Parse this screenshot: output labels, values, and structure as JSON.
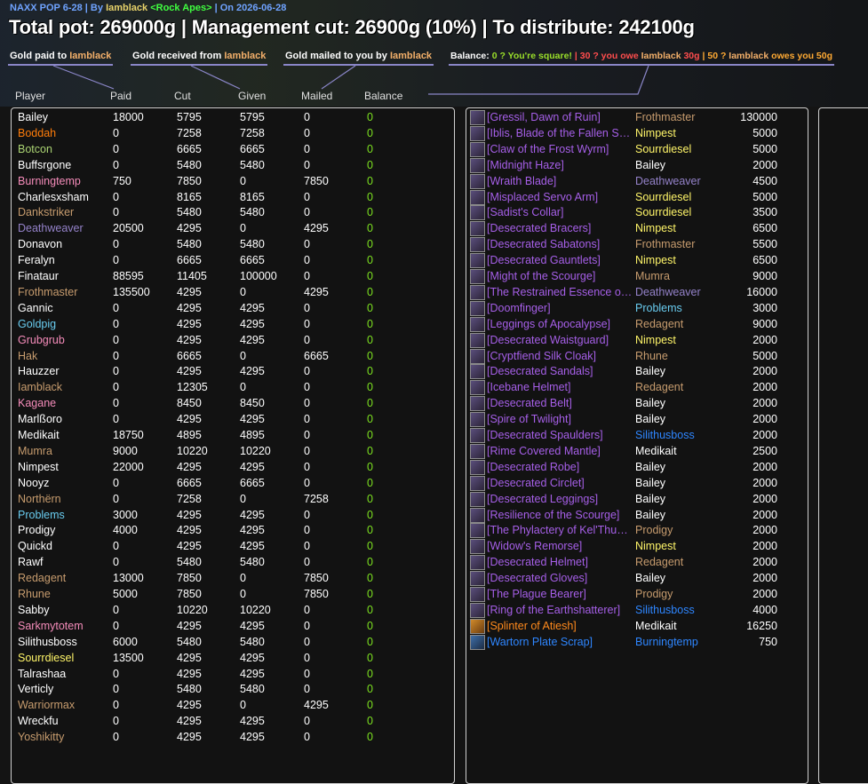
{
  "header": {
    "raid": "NAXX POP 6-28",
    "by_label": "| By",
    "author": "Iamblack",
    "guild": "<Rock Apes>",
    "date": "| On 2026-06-28"
  },
  "title": "Total pot: 269000g | Management cut: 26900g (10%) | To distribute: 242100g",
  "legend": {
    "paid_label": "Gold paid to",
    "paid_name": "Iamblack",
    "received_label": "Gold received from",
    "received_name": "Iamblack",
    "mailed_label": "Gold mailed to you by",
    "mailed_name": "Iamblack",
    "balance_label": "Balance:",
    "square": "0 ? You're square!",
    "sep": "|",
    "owe_prefix": "30 ? you owe",
    "owe_name": "Iamblack",
    "owe_amount": "30g",
    "owes_prefix": "50 ?",
    "owes_name": "Iamblack",
    "owes_suffix": "owes you 50g"
  },
  "columns": {
    "player": "Player",
    "paid": "Paid",
    "cut": "Cut",
    "given": "Given",
    "mailed": "Mailed",
    "balance": "Balance"
  },
  "colors": {
    "priest": "#ffffff",
    "druid": "#ff7d0a",
    "rogue": "#fff569",
    "hunter": "#abd473",
    "mage": "#69ccf0",
    "warlock": "#9482c9",
    "paladin": "#f58cba",
    "warrior": "#c79c6e",
    "epic": "#a65fe8",
    "legendary": "#ff8a1c",
    "rare": "#2e86ff",
    "balance_zero": "#7ce020"
  },
  "players": [
    {
      "name": "Bailey",
      "cls": "priest",
      "paid": "18000",
      "cut": "5795",
      "given": "5795",
      "mailed": "0",
      "balance": "0"
    },
    {
      "name": "Boddah",
      "cls": "druid",
      "paid": "0",
      "cut": "7258",
      "given": "7258",
      "mailed": "0",
      "balance": "0"
    },
    {
      "name": "Botcon",
      "cls": "hunter",
      "paid": "0",
      "cut": "6665",
      "given": "6665",
      "mailed": "0",
      "balance": "0"
    },
    {
      "name": "Buffsrgone",
      "cls": "priest",
      "paid": "0",
      "cut": "5480",
      "given": "5480",
      "mailed": "0",
      "balance": "0"
    },
    {
      "name": "Burningtemp",
      "cls": "paladin",
      "paid": "750",
      "cut": "7850",
      "given": "0",
      "mailed": "7850",
      "balance": "0"
    },
    {
      "name": "Charlesxsham",
      "cls": "priest",
      "paid": "0",
      "cut": "8165",
      "given": "8165",
      "mailed": "0",
      "balance": "0"
    },
    {
      "name": "Dankstriker",
      "cls": "warrior",
      "paid": "0",
      "cut": "5480",
      "given": "5480",
      "mailed": "0",
      "balance": "0"
    },
    {
      "name": "Deathweaver",
      "cls": "warlock",
      "paid": "20500",
      "cut": "4295",
      "given": "0",
      "mailed": "4295",
      "balance": "0"
    },
    {
      "name": "Donavon",
      "cls": "priest",
      "paid": "0",
      "cut": "5480",
      "given": "5480",
      "mailed": "0",
      "balance": "0"
    },
    {
      "name": "Feralyn",
      "cls": "priest",
      "paid": "0",
      "cut": "6665",
      "given": "6665",
      "mailed": "0",
      "balance": "0"
    },
    {
      "name": "Finataur",
      "cls": "priest",
      "paid": "88595",
      "cut": "11405",
      "given": "100000",
      "mailed": "0",
      "balance": "0"
    },
    {
      "name": "Frothmaster",
      "cls": "warrior",
      "paid": "135500",
      "cut": "4295",
      "given": "0",
      "mailed": "4295",
      "balance": "0"
    },
    {
      "name": "Gannic",
      "cls": "priest",
      "paid": "0",
      "cut": "4295",
      "given": "4295",
      "mailed": "0",
      "balance": "0"
    },
    {
      "name": "Goldpig",
      "cls": "mage",
      "paid": "0",
      "cut": "4295",
      "given": "4295",
      "mailed": "0",
      "balance": "0"
    },
    {
      "name": "Grubgrub",
      "cls": "paladin",
      "paid": "0",
      "cut": "4295",
      "given": "4295",
      "mailed": "0",
      "balance": "0"
    },
    {
      "name": "Hak",
      "cls": "warrior",
      "paid": "0",
      "cut": "6665",
      "given": "0",
      "mailed": "6665",
      "balance": "0"
    },
    {
      "name": "Hauzzer",
      "cls": "priest",
      "paid": "0",
      "cut": "4295",
      "given": "4295",
      "mailed": "0",
      "balance": "0"
    },
    {
      "name": "Iamblack",
      "cls": "warrior",
      "paid": "0",
      "cut": "12305",
      "given": "0",
      "mailed": "0",
      "balance": "0"
    },
    {
      "name": "Kagane",
      "cls": "paladin",
      "paid": "0",
      "cut": "8450",
      "given": "8450",
      "mailed": "0",
      "balance": "0"
    },
    {
      "name": "Marlßoro",
      "cls": "priest",
      "paid": "0",
      "cut": "4295",
      "given": "4295",
      "mailed": "0",
      "balance": "0"
    },
    {
      "name": "Medikait",
      "cls": "priest",
      "paid": "18750",
      "cut": "4895",
      "given": "4895",
      "mailed": "0",
      "balance": "0"
    },
    {
      "name": "Mumra",
      "cls": "warrior",
      "paid": "9000",
      "cut": "10220",
      "given": "10220",
      "mailed": "0",
      "balance": "0"
    },
    {
      "name": "Nimpest",
      "cls": "priest",
      "paid": "22000",
      "cut": "4295",
      "given": "4295",
      "mailed": "0",
      "balance": "0"
    },
    {
      "name": "Nooyz",
      "cls": "priest",
      "paid": "0",
      "cut": "6665",
      "given": "6665",
      "mailed": "0",
      "balance": "0"
    },
    {
      "name": "Northërn",
      "cls": "warrior",
      "paid": "0",
      "cut": "7258",
      "given": "0",
      "mailed": "7258",
      "balance": "0"
    },
    {
      "name": "Problems",
      "cls": "mage",
      "paid": "3000",
      "cut": "4295",
      "given": "4295",
      "mailed": "0",
      "balance": "0"
    },
    {
      "name": "Prodigy",
      "cls": "priest",
      "paid": "4000",
      "cut": "4295",
      "given": "4295",
      "mailed": "0",
      "balance": "0"
    },
    {
      "name": "Quickd",
      "cls": "priest",
      "paid": "0",
      "cut": "4295",
      "given": "4295",
      "mailed": "0",
      "balance": "0"
    },
    {
      "name": "Rawf",
      "cls": "priest",
      "paid": "0",
      "cut": "5480",
      "given": "5480",
      "mailed": "0",
      "balance": "0"
    },
    {
      "name": "Redagent",
      "cls": "warrior",
      "paid": "13000",
      "cut": "7850",
      "given": "0",
      "mailed": "7850",
      "balance": "0"
    },
    {
      "name": "Rhune",
      "cls": "warrior",
      "paid": "5000",
      "cut": "7850",
      "given": "0",
      "mailed": "7850",
      "balance": "0"
    },
    {
      "name": "Sabby",
      "cls": "priest",
      "paid": "0",
      "cut": "10220",
      "given": "10220",
      "mailed": "0",
      "balance": "0"
    },
    {
      "name": "Sarkmytotem",
      "cls": "paladin",
      "paid": "0",
      "cut": "4295",
      "given": "4295",
      "mailed": "0",
      "balance": "0"
    },
    {
      "name": "Silithusboss",
      "cls": "priest",
      "paid": "6000",
      "cut": "5480",
      "given": "5480",
      "mailed": "0",
      "balance": "0"
    },
    {
      "name": "Sourrdiesel",
      "cls": "rogue",
      "paid": "13500",
      "cut": "4295",
      "given": "4295",
      "mailed": "0",
      "balance": "0"
    },
    {
      "name": "Talrashaa",
      "cls": "priest",
      "paid": "0",
      "cut": "4295",
      "given": "4295",
      "mailed": "0",
      "balance": "0"
    },
    {
      "name": "Verticly",
      "cls": "priest",
      "paid": "0",
      "cut": "5480",
      "given": "5480",
      "mailed": "0",
      "balance": "0"
    },
    {
      "name": "Warriormax",
      "cls": "warrior",
      "paid": "0",
      "cut": "4295",
      "given": "0",
      "mailed": "4295",
      "balance": "0"
    },
    {
      "name": "Wreckfu",
      "cls": "priest",
      "paid": "0",
      "cut": "4295",
      "given": "4295",
      "mailed": "0",
      "balance": "0"
    },
    {
      "name": "Yoshikitty",
      "cls": "warrior",
      "paid": "0",
      "cut": "4295",
      "given": "4295",
      "mailed": "0",
      "balance": "0"
    }
  ],
  "items": [
    {
      "name": "[Gressil, Dawn of Ruin]",
      "q": "epic",
      "winner": "Frothmaster",
      "cls": "warrior",
      "amount": "130000"
    },
    {
      "name": "[Iblis, Blade of the Fallen Seraph]",
      "q": "epic",
      "winner": "Nimpest",
      "cls": "rogue",
      "amount": "5000"
    },
    {
      "name": "[Claw of the Frost Wyrm]",
      "q": "epic",
      "winner": "Sourrdiesel",
      "cls": "rogue",
      "amount": "5000"
    },
    {
      "name": "[Midnight Haze]",
      "q": "epic",
      "winner": "Bailey",
      "cls": "priest",
      "amount": "2000"
    },
    {
      "name": "[Wraith Blade]",
      "q": "epic",
      "winner": "Deathweaver",
      "cls": "warlock",
      "amount": "4500"
    },
    {
      "name": "[Misplaced Servo Arm]",
      "q": "epic",
      "winner": "Sourrdiesel",
      "cls": "rogue",
      "amount": "5000"
    },
    {
      "name": "[Sadist's Collar]",
      "q": "epic",
      "winner": "Sourrdiesel",
      "cls": "rogue",
      "amount": "3500"
    },
    {
      "name": "[Desecrated Bracers]",
      "q": "epic",
      "winner": "Nimpest",
      "cls": "rogue",
      "amount": "6500"
    },
    {
      "name": "[Desecrated Sabatons]",
      "q": "epic",
      "winner": "Frothmaster",
      "cls": "warrior",
      "amount": "5500"
    },
    {
      "name": "[Desecrated Gauntlets]",
      "q": "epic",
      "winner": "Nimpest",
      "cls": "rogue",
      "amount": "6500"
    },
    {
      "name": "[Might of the Scourge]",
      "q": "epic",
      "winner": "Mumra",
      "cls": "warrior",
      "amount": "9000"
    },
    {
      "name": "[The Restrained Essence of Sapphiron]",
      "q": "epic",
      "winner": "Deathweaver",
      "cls": "warlock",
      "amount": "16000"
    },
    {
      "name": "[Doomfinger]",
      "q": "epic",
      "winner": "Problems",
      "cls": "mage",
      "amount": "3000"
    },
    {
      "name": "[Leggings of Apocalypse]",
      "q": "epic",
      "winner": "Redagent",
      "cls": "warrior",
      "amount": "9000"
    },
    {
      "name": "[Desecrated Waistguard]",
      "q": "epic",
      "winner": "Nimpest",
      "cls": "rogue",
      "amount": "2000"
    },
    {
      "name": "[Cryptfiend Silk Cloak]",
      "q": "epic",
      "winner": "Rhune",
      "cls": "warrior",
      "amount": "5000"
    },
    {
      "name": "[Desecrated Sandals]",
      "q": "epic",
      "winner": "Bailey",
      "cls": "priest",
      "amount": "2000"
    },
    {
      "name": "[Icebane Helmet]",
      "q": "epic",
      "winner": "Redagent",
      "cls": "warrior",
      "amount": "2000"
    },
    {
      "name": "[Desecrated Belt]",
      "q": "epic",
      "winner": "Bailey",
      "cls": "priest",
      "amount": "2000"
    },
    {
      "name": "[Spire of Twilight]",
      "q": "epic",
      "winner": "Bailey",
      "cls": "priest",
      "amount": "2000"
    },
    {
      "name": "[Desecrated Spaulders]",
      "q": "epic",
      "winner": "Silithusboss",
      "cls": "rare",
      "amount": "2000"
    },
    {
      "name": "[Rime Covered Mantle]",
      "q": "epic",
      "winner": "Medikait",
      "cls": "priest",
      "amount": "2500"
    },
    {
      "name": "[Desecrated Robe]",
      "q": "epic",
      "winner": "Bailey",
      "cls": "priest",
      "amount": "2000"
    },
    {
      "name": "[Desecrated Circlet]",
      "q": "epic",
      "winner": "Bailey",
      "cls": "priest",
      "amount": "2000"
    },
    {
      "name": "[Desecrated Leggings]",
      "q": "epic",
      "winner": "Bailey",
      "cls": "priest",
      "amount": "2000"
    },
    {
      "name": "[Resilience of the Scourge]",
      "q": "epic",
      "winner": "Bailey",
      "cls": "priest",
      "amount": "2000"
    },
    {
      "name": "[The Phylactery of Kel'Thuzad]",
      "q": "epic",
      "winner": "Prodigy",
      "cls": "warrior",
      "amount": "2000"
    },
    {
      "name": "[Widow's Remorse]",
      "q": "epic",
      "winner": "Nimpest",
      "cls": "rogue",
      "amount": "2000"
    },
    {
      "name": "[Desecrated Helmet]",
      "q": "epic",
      "winner": "Redagent",
      "cls": "warrior",
      "amount": "2000"
    },
    {
      "name": "[Desecrated Gloves]",
      "q": "epic",
      "winner": "Bailey",
      "cls": "priest",
      "amount": "2000"
    },
    {
      "name": "[The Plague Bearer]",
      "q": "epic",
      "winner": "Prodigy",
      "cls": "warrior",
      "amount": "2000"
    },
    {
      "name": "[Ring of the Earthshatterer]",
      "q": "epic",
      "winner": "Silithusboss",
      "cls": "rare",
      "amount": "4000"
    },
    {
      "name": "[Splinter of Atiesh]",
      "q": "leg",
      "winner": "Medikait",
      "cls": "priest",
      "amount": "16250"
    },
    {
      "name": "[Wartorn Plate Scrap]",
      "q": "rare",
      "winner": "Burningtemp",
      "cls": "rare",
      "amount": "750"
    }
  ]
}
